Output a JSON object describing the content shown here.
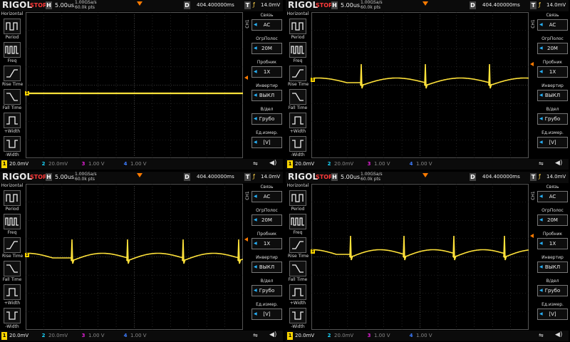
{
  "brand": "RIGOL",
  "status": "STOP",
  "horizontal_label": "H",
  "timebase": "5.00us",
  "sample_rate": "1.00GSa/s",
  "memory_depth": "60.0k pts",
  "delay_label": "D",
  "delay": "404.400000ms",
  "trigger_label": "T",
  "trigger_edge": "ƒ",
  "trigger_level": "14.0mV",
  "left_menu": {
    "header": "Horizontal",
    "items": [
      {
        "label": "Period",
        "icon": "period-icon"
      },
      {
        "label": "Freq",
        "icon": "freq-icon"
      },
      {
        "label": "Rise Time",
        "icon": "rise-time-icon"
      },
      {
        "label": "Fall Time",
        "icon": "fall-time-icon"
      },
      {
        "label": "+Width",
        "icon": "plus-width-icon"
      },
      {
        "label": "-Width",
        "icon": "minus-width-icon"
      }
    ]
  },
  "right_menu": {
    "tab": "CH1",
    "items": [
      {
        "title": "Связь",
        "value": "AC"
      },
      {
        "title": "ОгрПолос",
        "value": "20M"
      },
      {
        "title": "Пробник",
        "value": "1X"
      },
      {
        "title": "Инвертир",
        "value": "ВЫКЛ"
      },
      {
        "title": "В/дел",
        "value": "Грубо"
      },
      {
        "title": "Ед.измер.",
        "value": "[V]"
      }
    ]
  },
  "channels": [
    {
      "num": "1",
      "value": "20.0mV",
      "color": "#ffd700"
    },
    {
      "num": "2",
      "value": "20.0mV",
      "color": "#19d7ff"
    },
    {
      "num": "3",
      "value": "1.00 V",
      "color": "#e21fd6"
    },
    {
      "num": "4",
      "value": "1.00 V",
      "color": "#3d7cff"
    }
  ],
  "ch1_marker": "1",
  "colors": {
    "trace": "#ffe23a",
    "grid": "#3a3a3a",
    "trigger": "#ff7b00",
    "accent": "#28b4ff"
  },
  "panels": [
    {
      "id": "flat"
    },
    {
      "id": "spikes-3"
    },
    {
      "id": "spikes-4a"
    },
    {
      "id": "spikes-4b"
    }
  ]
}
